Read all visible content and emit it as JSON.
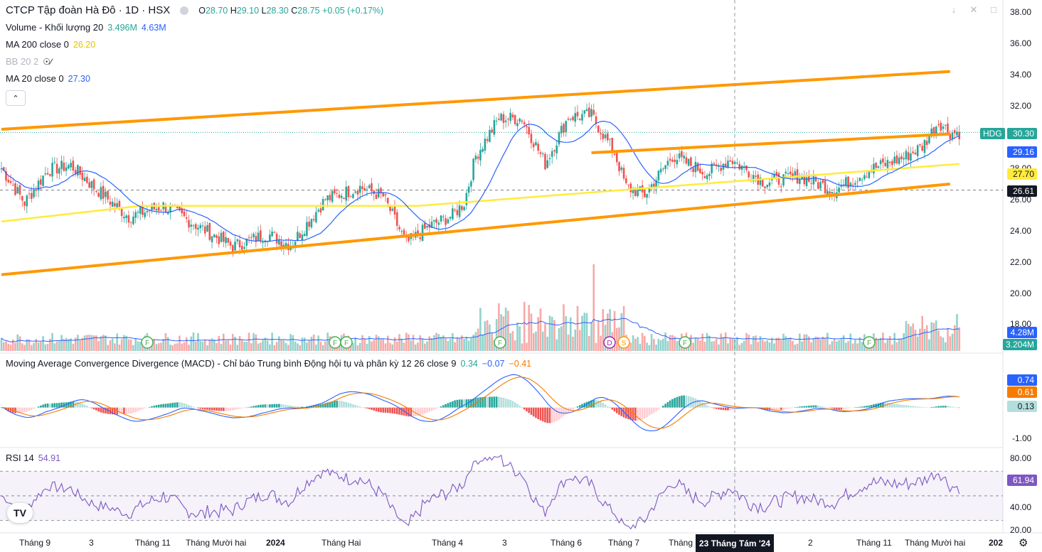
{
  "header": {
    "symbol_title": "CTCP Tập đoàn Hà Đô · 1D · HSX",
    "ohlc": {
      "o_label": "O",
      "o": "28.70",
      "h_label": "H",
      "h": "29.10",
      "l_label": "L",
      "l": "28.30",
      "c_label": "C",
      "c": "28.75",
      "change": "+0.05 (+0.17%)"
    }
  },
  "indicators": [
    {
      "label": "Volume - Khối lượng 20",
      "values": [
        "3.496M",
        "4.63M"
      ],
      "colors": [
        "#26a69a",
        "#2962ff"
      ]
    },
    {
      "label": "MA 200 close 0",
      "values": [
        "26.20"
      ],
      "colors": [
        "#e0c500"
      ]
    },
    {
      "label": "BB 20 2",
      "values": [],
      "colors": [],
      "hidden": true
    },
    {
      "label": "MA 20 close 0",
      "values": [
        "27.30"
      ],
      "colors": [
        "#2962ff"
      ]
    }
  ],
  "macd_legend": {
    "label": "Moving Average Convergence Divergence (MACD) - Chỉ báo Trung bình Động hội tụ và phân kỳ 12 26 close 9",
    "values": [
      "0.34",
      "−0.07",
      "−0.41"
    ],
    "colors": [
      "#26a69a",
      "#2962ff",
      "#f57c00"
    ]
  },
  "rsi_legend": {
    "label": "RSI 14",
    "value": "54.91",
    "color": "#7e57c2"
  },
  "price_axis": [
    "38.00",
    "36.00",
    "34.00",
    "32.00",
    "28.00",
    "26.00",
    "24.00",
    "22.00",
    "20.00",
    "18.00"
  ],
  "price_tags": [
    {
      "text": "HDG",
      "value": "30.30",
      "color": "#26a69a"
    },
    {
      "text": "",
      "value": "29.16",
      "color": "#2962ff"
    },
    {
      "text": "",
      "value": "27.70",
      "color": "#ffeb3b",
      "dark": true
    },
    {
      "text": "",
      "value": "26.61",
      "color": "#131722"
    }
  ],
  "volume_tags": [
    {
      "value": "4.28M",
      "color": "#2962ff"
    },
    {
      "value": "3.204M",
      "color": "#26a69a"
    }
  ],
  "macd_axis": [
    "-1.00"
  ],
  "macd_tags": [
    {
      "value": "0.74",
      "color": "#2962ff"
    },
    {
      "value": "0.61",
      "color": "#f57c00"
    },
    {
      "value": "0.13",
      "color": "#b2dfdb",
      "dark": true
    }
  ],
  "rsi_axis": [
    "80.00",
    "40.00",
    "20.00"
  ],
  "rsi_tag": {
    "value": "61.94",
    "color": "#7e57c2"
  },
  "time_axis": [
    "Tháng 9",
    "3",
    "Tháng 11",
    "Tháng Mười hai",
    "2024",
    "Tháng Hai",
    "Tháng 4",
    "3",
    "Tháng 6",
    "Tháng 7",
    "Tháng",
    "2",
    "Tháng 11",
    "Tháng Mười hai",
    "202"
  ],
  "crosshair_date": "23 Tháng Tám '24",
  "events": [
    "F",
    "F",
    "F",
    "F",
    "D",
    "S",
    "F",
    "F"
  ],
  "logo_text": "TV",
  "chart_data": {
    "type": "candlestick",
    "symbol": "HDG",
    "price_ylim": [
      20,
      38.5
    ],
    "last_price": 30.3,
    "ma20_last": 29.16,
    "ma200_last": 27.7,
    "support_level": 26.61,
    "close_anchors": [
      [
        0,
        28
      ],
      [
        10,
        25.8
      ],
      [
        20,
        27.9
      ],
      [
        30,
        28.2
      ],
      [
        40,
        26.8
      ],
      [
        55,
        24.9
      ],
      [
        70,
        25.6
      ],
      [
        85,
        24.3
      ],
      [
        100,
        23.0
      ],
      [
        115,
        23.8
      ],
      [
        125,
        23.1
      ],
      [
        140,
        26.0
      ],
      [
        155,
        26.8
      ],
      [
        165,
        26.2
      ],
      [
        175,
        23.2
      ],
      [
        185,
        24.3
      ],
      [
        195,
        25.0
      ],
      [
        200,
        25.8
      ],
      [
        205,
        28.8
      ],
      [
        215,
        31.2
      ],
      [
        225,
        31.2
      ],
      [
        235,
        28.3
      ],
      [
        245,
        31.3
      ],
      [
        255,
        31.4
      ],
      [
        265,
        29.0
      ],
      [
        270,
        26.8
      ],
      [
        278,
        26.3
      ],
      [
        290,
        28.8
      ],
      [
        305,
        27.7
      ],
      [
        315,
        28.6
      ],
      [
        330,
        27.1
      ],
      [
        345,
        27.5
      ],
      [
        360,
        26.6
      ],
      [
        375,
        27.9
      ],
      [
        390,
        28.7
      ],
      [
        398,
        29.4
      ],
      [
        405,
        31.0
      ],
      [
        410,
        30.3
      ]
    ],
    "channel_upper": [
      [
        0,
        30.5
      ],
      [
        410,
        34.2
      ]
    ],
    "channel_lower": [
      [
        0,
        21.2
      ],
      [
        410,
        27.0
      ]
    ],
    "inner_upper": [
      [
        255,
        29.0
      ],
      [
        410,
        30.2
      ]
    ],
    "macd_ylim": [
      -1.4,
      1.6
    ],
    "rsi_ylim": [
      20,
      88
    ],
    "rsi_bands": [
      30,
      70
    ]
  }
}
